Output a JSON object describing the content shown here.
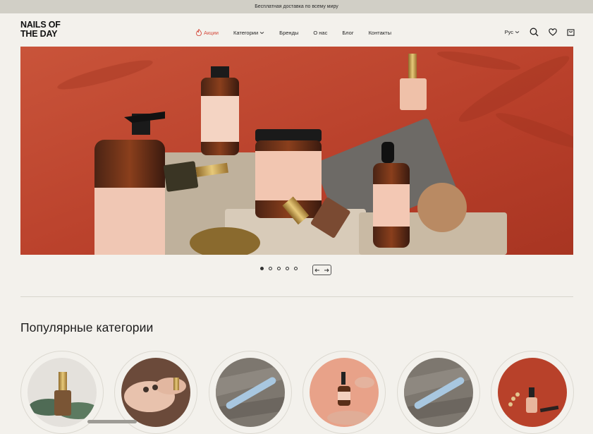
{
  "promo": {
    "text": "Бесплатная доставка по всему миру"
  },
  "logo": {
    "line1": "NAILS OF",
    "line2": "THE DAY"
  },
  "nav": {
    "items": [
      {
        "label": "Акции"
      },
      {
        "label": "Категории"
      },
      {
        "label": "Бренды"
      },
      {
        "label": "О нас"
      },
      {
        "label": "Блог"
      },
      {
        "label": "Контакты"
      }
    ]
  },
  "header_right": {
    "language": "Рус"
  },
  "slider": {
    "dots": 5,
    "active_dot": 1
  },
  "categories": {
    "title": "Популярные категории",
    "items": [
      {
        "image": "green-nail-polish"
      },
      {
        "image": "hands-with-polish"
      },
      {
        "image": "nail-file-on-bark"
      },
      {
        "image": "serum-dropper"
      },
      {
        "image": "nail-file-on-bark"
      },
      {
        "image": "bottles-on-red"
      }
    ]
  },
  "colors": {
    "accent": "#d44a3c",
    "background": "#f3f1ec",
    "promo_bar": "#d1cfc6"
  }
}
